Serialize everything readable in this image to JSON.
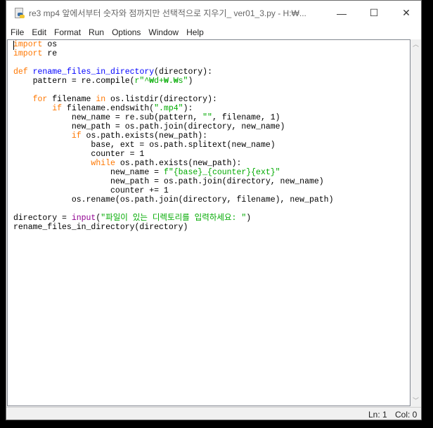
{
  "window": {
    "title": "re3 mp4 앞에서부터 숫자와 점까지만 선택적으로 지우기_ ver01_3.py - H:₩...",
    "minimize": "—",
    "maximize": "☐",
    "close": "✕"
  },
  "menu": [
    "File",
    "Edit",
    "Format",
    "Run",
    "Options",
    "Window",
    "Help"
  ],
  "code": [
    [
      [
        "import",
        "kw"
      ],
      [
        " os",
        ""
      ]
    ],
    [
      [
        "import",
        "kw"
      ],
      [
        " re",
        ""
      ]
    ],
    [],
    [
      [
        "def",
        "kw"
      ],
      [
        " ",
        ""
      ],
      [
        "rename_files_in_directory",
        "fn"
      ],
      [
        "(directory):",
        ""
      ]
    ],
    [
      [
        "    pattern = re.compile(",
        ""
      ],
      [
        "r\"^₩d+₩.₩s\"",
        "st"
      ],
      [
        ")",
        ""
      ]
    ],
    [],
    [
      [
        "    ",
        ""
      ],
      [
        "for",
        "kw"
      ],
      [
        " filename ",
        ""
      ],
      [
        "in",
        "kw"
      ],
      [
        " os.listdir(directory):",
        ""
      ]
    ],
    [
      [
        "        ",
        ""
      ],
      [
        "if",
        "kw"
      ],
      [
        " filename.endswith(",
        ""
      ],
      [
        "\".mp4\"",
        "st"
      ],
      [
        "):",
        ""
      ]
    ],
    [
      [
        "            new_name = re.sub(pattern, ",
        ""
      ],
      [
        "\"\"",
        "st"
      ],
      [
        ", filename, 1)",
        ""
      ]
    ],
    [
      [
        "            new_path = os.path.join(directory, new_name)",
        ""
      ]
    ],
    [
      [
        "            ",
        ""
      ],
      [
        "if",
        "kw"
      ],
      [
        " os.path.exists(new_path):",
        ""
      ]
    ],
    [
      [
        "                base, ext = os.path.splitext(new_name)",
        ""
      ]
    ],
    [
      [
        "                counter = 1",
        ""
      ]
    ],
    [
      [
        "                ",
        ""
      ],
      [
        "while",
        "kw"
      ],
      [
        " os.path.exists(new_path):",
        ""
      ]
    ],
    [
      [
        "                    new_name = ",
        ""
      ],
      [
        "f\"{base}_{counter}{ext}\"",
        "st"
      ]
    ],
    [
      [
        "                    new_path = os.path.join(directory, new_name)",
        ""
      ]
    ],
    [
      [
        "                    counter += 1",
        ""
      ]
    ],
    [
      [
        "            os.rename(os.path.join(directory, filename), new_path)",
        ""
      ]
    ],
    [],
    [
      [
        "directory = ",
        ""
      ],
      [
        "input",
        "bi"
      ],
      [
        "(",
        ""
      ],
      [
        "\"파일이 있는 디렉토리를 입력하세요: \"",
        "st"
      ],
      [
        ")",
        ""
      ]
    ],
    [
      [
        "rename_files_in_directory(directory)",
        ""
      ]
    ]
  ],
  "status": {
    "line": "Ln: 1",
    "col": "Col: 0"
  }
}
